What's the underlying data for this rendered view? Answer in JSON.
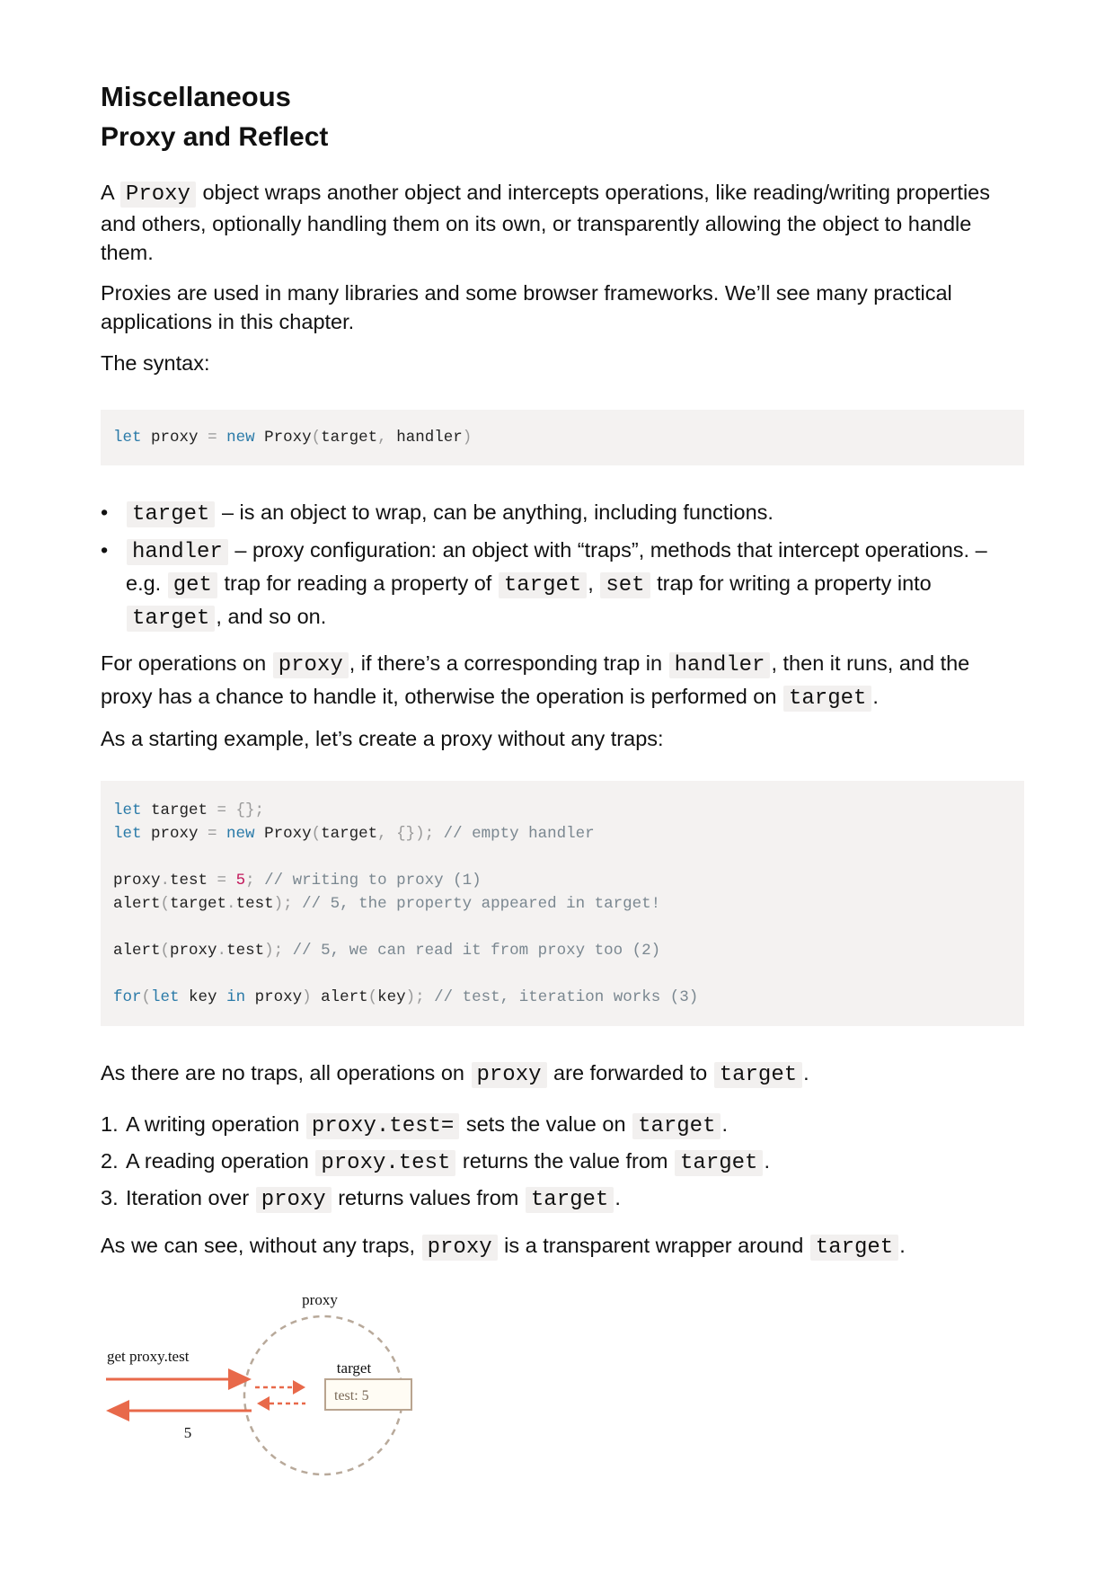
{
  "section_title": "Miscellaneous",
  "chapter_title": "Proxy and Reflect",
  "intro": {
    "p1_a": "A",
    "p1_code": "Proxy",
    "p1_b": "object wraps another object and intercepts operations, like reading/writing properties and others, optionally handling them on its own, or transparently allowing the object to handle them.",
    "p2": "Proxies are used in many libraries and some browser frameworks. We’ll see many practical applications in this chapter.",
    "p3": "The syntax:"
  },
  "syntax_code": {
    "kw_let": "let",
    "var_proxy": "proxy",
    "op_eq": "=",
    "kw_new": "new",
    "cls_proxy": "Proxy",
    "paren_open": "(",
    "arg_target": "target",
    "comma": ",",
    "arg_handler": "handler",
    "paren_close": ")"
  },
  "bullets": {
    "b1_code": "target",
    "b1_text": "– is an object to wrap, can be anything, including functions.",
    "b2_code": "handler",
    "b2_a": "– proxy configuration: an object with “traps”, methods that intercept operations. – e.g.",
    "b2_code_get": "get",
    "b2_b": "trap for reading a property of",
    "b2_code_target1": "target",
    "b2_c": ",",
    "b2_code_set": "set",
    "b2_d": "trap for writing a property into",
    "b2_code_target2": "target",
    "b2_e": ", and so on.",
    "bullet_char": "•"
  },
  "para_ops": {
    "a": "For operations on",
    "code_proxy": "proxy",
    "b": ", if there’s a corresponding trap in",
    "code_handler": "handler",
    "c": ", then it runs, and the proxy has a chance to handle it, otherwise the operation is performed on",
    "code_target": "target",
    "d": "."
  },
  "para_example": "As a starting example, let’s create a proxy without any traps:",
  "example_code": {
    "l1": {
      "kw": "let",
      "v": " target ",
      "eq": "=",
      "rest": " {};"
    },
    "l2": {
      "kw": "let",
      "v": " proxy ",
      "eq": "=",
      "kw2": " new",
      "cls": " Proxy",
      "p1": "(",
      "arg": "target",
      "p2": ", {});",
      "cm": " // empty handler"
    },
    "l4": {
      "v1": "proxy",
      "dot": ".",
      "v2": "test ",
      "eq": "=",
      "num": " 5",
      "semi": ";",
      "cm": " // writing to proxy (1)"
    },
    "l5": {
      "fn": "alert",
      "p1": "(",
      "v1": "target",
      "dot": ".",
      "v2": "test",
      "p2": ");",
      "cm": " // 5, the property appeared in target!"
    },
    "l7": {
      "fn": "alert",
      "p1": "(",
      "v1": "proxy",
      "dot": ".",
      "v2": "test",
      "p2": ");",
      "cm": " // 5, we can read it from proxy too (2)"
    },
    "l9": {
      "kw": "for",
      "p1": "(",
      "kw2": "let",
      "v": " key ",
      "kw3": "in",
      "v2": " proxy",
      "p2": ")",
      "fn": " alert",
      "p3": "(",
      "v3": "key",
      "p4": ");",
      "cm": " // test, iteration works (3)"
    }
  },
  "para_forward": {
    "a": "As there are no traps, all operations on",
    "code_proxy": "proxy",
    "b": "are forwarded to",
    "code_target": "target",
    "c": "."
  },
  "numbered": [
    {
      "n": "1.",
      "a": "A writing operation",
      "code1": "proxy.test=",
      "b": "sets the value on",
      "code2": "target",
      "c": "."
    },
    {
      "n": "2.",
      "a": "A reading operation",
      "code1": "proxy.test",
      "b": "returns the value from",
      "code2": "target",
      "c": "."
    },
    {
      "n": "3.",
      "a": "Iteration over",
      "code1": "proxy",
      "b": "returns values from",
      "code2": "target",
      "c": "."
    }
  ],
  "para_transparent": {
    "a": "As we can see, without any traps,",
    "code_proxy": "proxy",
    "b": "is a transparent wrapper around",
    "code_target": "target",
    "c": "."
  },
  "diagram": {
    "label_proxy": "proxy",
    "label_get": "get proxy.test",
    "label_target": "target",
    "label_value": "test: 5",
    "label_result": "5",
    "arrow_color": "#e8694a",
    "circle_color": "#b8a99a",
    "box_border": "#b9a48f",
    "box_fill": "#fffcf4"
  }
}
